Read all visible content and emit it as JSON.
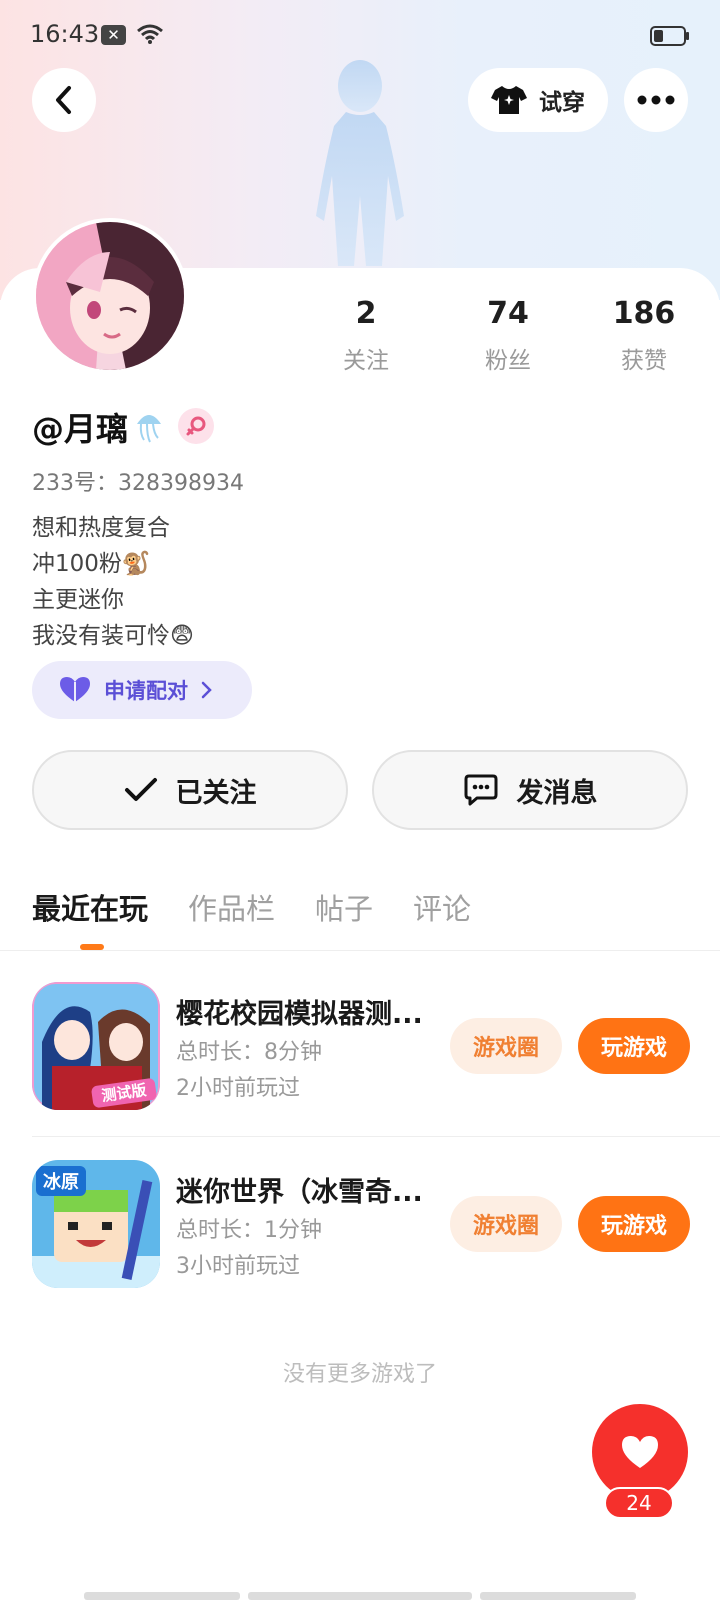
{
  "status_bar": {
    "time": "16:43"
  },
  "header": {
    "try_on_label": "试穿"
  },
  "profile": {
    "username": "@月璃",
    "uid": "233号：328398934",
    "bio": [
      "想和热度复合",
      "冲100粉🐒",
      "主更迷你",
      "我没有装可怜😨"
    ],
    "stats": [
      {
        "value": "2",
        "label": "关注"
      },
      {
        "value": "74",
        "label": "粉丝"
      },
      {
        "value": "186",
        "label": "获赞"
      }
    ],
    "pair_label": "申请配对"
  },
  "actions": {
    "follow_label": "已关注",
    "message_label": "发消息"
  },
  "tabs": [
    "最近在玩",
    "作品栏",
    "帖子",
    "评论"
  ],
  "games": [
    {
      "title": "樱花校园模拟器测...",
      "duration": "总时长：8分钟",
      "last_played": "2小时前玩过",
      "circle_label": "游戏圈",
      "play_label": "玩游戏",
      "icon": "sakura-school-game-icon",
      "icon_text": "测试版"
    },
    {
      "title": "迷你世界（冰雪奇...",
      "duration": "总时长：1分钟",
      "last_played": "3小时前玩过",
      "circle_label": "游戏圈",
      "play_label": "玩游戏",
      "icon": "mini-world-game-icon",
      "icon_text": "冰原"
    }
  ],
  "footer": {
    "no_more": "没有更多游戏了",
    "like_count": "24"
  },
  "colors": {
    "accent": "#ff7314",
    "like": "#f5302c",
    "pair": "#5b4fd6"
  }
}
